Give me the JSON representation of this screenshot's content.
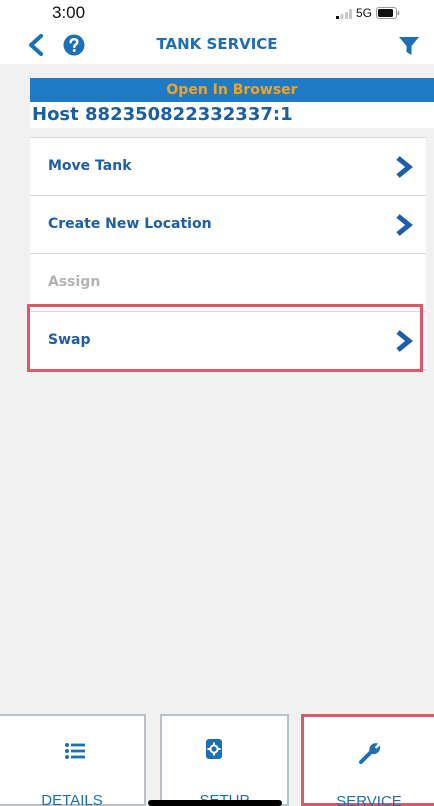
{
  "status_bar": {
    "time": "3:00",
    "network": "5G"
  },
  "nav": {
    "title": "TANK SERVICE",
    "back_icon": "chevron-left-icon",
    "help_icon": "question-circle-icon",
    "filter_icon": "filter-icon"
  },
  "browser_bar": {
    "label": "Open In Browser"
  },
  "host": {
    "text": "Host 882350822332337:1"
  },
  "menu": {
    "items": [
      {
        "label": "Move Tank",
        "enabled": true
      },
      {
        "label": "Create New Location",
        "enabled": true
      },
      {
        "label": "Assign",
        "enabled": false
      },
      {
        "label": "Swap",
        "enabled": true,
        "highlighted": true
      }
    ]
  },
  "tabs": [
    {
      "label": "DETAILS",
      "icon": "list-icon",
      "selected": false
    },
    {
      "label": "SETUP",
      "icon": "settings-icon",
      "selected": false
    },
    {
      "label": "SERVICE",
      "icon": "wrench-icon",
      "selected": true
    }
  ],
  "colors": {
    "accent_blue": "#1c6fb4",
    "browser_bar_bg": "#1f7bc4",
    "browser_bar_text": "#f7a21d",
    "highlight_red": "#e0576c",
    "disabled_text": "#b3b3b3"
  }
}
